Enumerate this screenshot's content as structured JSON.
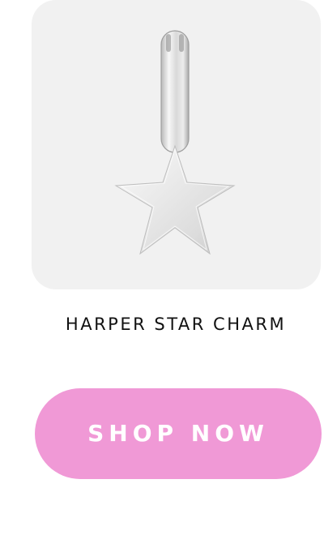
{
  "product": {
    "image_alt": "Silver star charm pendant",
    "title": "HARPER STAR CHARM",
    "card_background": "#f1f1f1"
  },
  "cta": {
    "label": "SHOP NOW",
    "background": "#f099d6",
    "text_color": "#ffffff"
  }
}
